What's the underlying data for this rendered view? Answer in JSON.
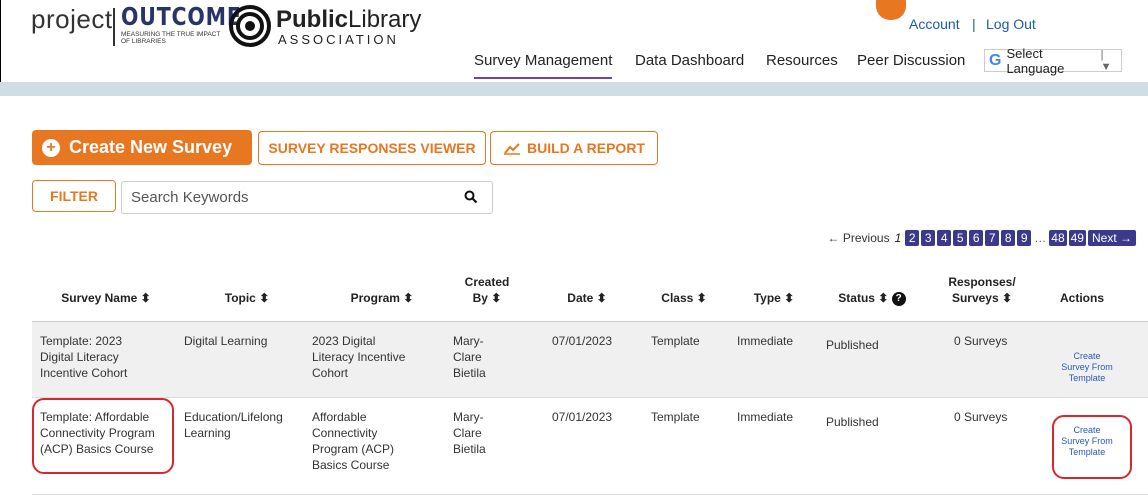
{
  "header": {
    "logo_project": "project",
    "logo_outcome": "OUTCOME",
    "logo_tagline": "MEASURING THE TRUE IMPACT OF LIBRARIES",
    "pla_public": "Public",
    "pla_library": "Library",
    "pla_association": "ASSOCIATION",
    "account": "Account",
    "separator": "|",
    "logout": "Log Out",
    "nav": [
      "Survey Management",
      "Data Dashboard",
      "Resources",
      "Peer Discussion"
    ],
    "active_nav": "Survey Management",
    "language": "Select Language",
    "google_icon": "G"
  },
  "toolbar": {
    "create_label": "Create New Survey",
    "viewer_label": "SURVEY RESPONSES VIEWER",
    "report_label": "BUILD A REPORT",
    "filter_label": "FILTER",
    "search_placeholder": "Search Keywords"
  },
  "pagination": {
    "previous": "← Previous",
    "current": "1",
    "pages": [
      "2",
      "3",
      "4",
      "5",
      "6",
      "7",
      "8",
      "9"
    ],
    "ellipsis": "…",
    "last_pages": [
      "48",
      "49"
    ],
    "next": "Next →"
  },
  "table": {
    "headers": {
      "name": "Survey Name ⬍",
      "topic": "Topic ⬍",
      "program": "Program ⬍",
      "created_1": "Created",
      "created_2": "By ⬍",
      "date": "Date ⬍",
      "class": "Class ⬍",
      "type": "Type ⬍",
      "status": "Status ⬍",
      "responses_1": "Responses/",
      "responses_2": "Surveys ⬍",
      "actions": "Actions"
    },
    "rows": [
      {
        "name": [
          "Template: 2023",
          "Digital Literacy",
          "Incentive Cohort"
        ],
        "topic": [
          "Digital Learning"
        ],
        "program": [
          "2023 Digital",
          "Literacy Incentive",
          "Cohort"
        ],
        "created_by": [
          "Mary-",
          "Clare",
          "Bietila"
        ],
        "date": "07/01/2023",
        "class": "Template",
        "type": "Immediate",
        "status": "Published",
        "responses": "0 Surveys",
        "action": [
          "Create",
          "Survey From",
          "Template"
        ]
      },
      {
        "name": [
          "Template: Affordable",
          "Connectivity Program",
          "(ACP) Basics Course"
        ],
        "topic": [
          "Education/Lifelong",
          "Learning"
        ],
        "program": [
          "Affordable",
          "Connectivity",
          "Program (ACP)",
          "Basics Course"
        ],
        "created_by": [
          "Mary-",
          "Clare",
          "Bietila"
        ],
        "date": "07/01/2023",
        "class": "Template",
        "type": "Immediate",
        "status": "Published",
        "responses": "0 Surveys",
        "action": [
          "Create",
          "Survey From",
          "Template"
        ]
      }
    ]
  },
  "colors": {
    "accent_orange": "#e87722",
    "brand_navy": "#26346b",
    "link_blue": "#1a5dab",
    "pager_purple": "#3a3a8c",
    "highlight_red": "#d8262e"
  }
}
